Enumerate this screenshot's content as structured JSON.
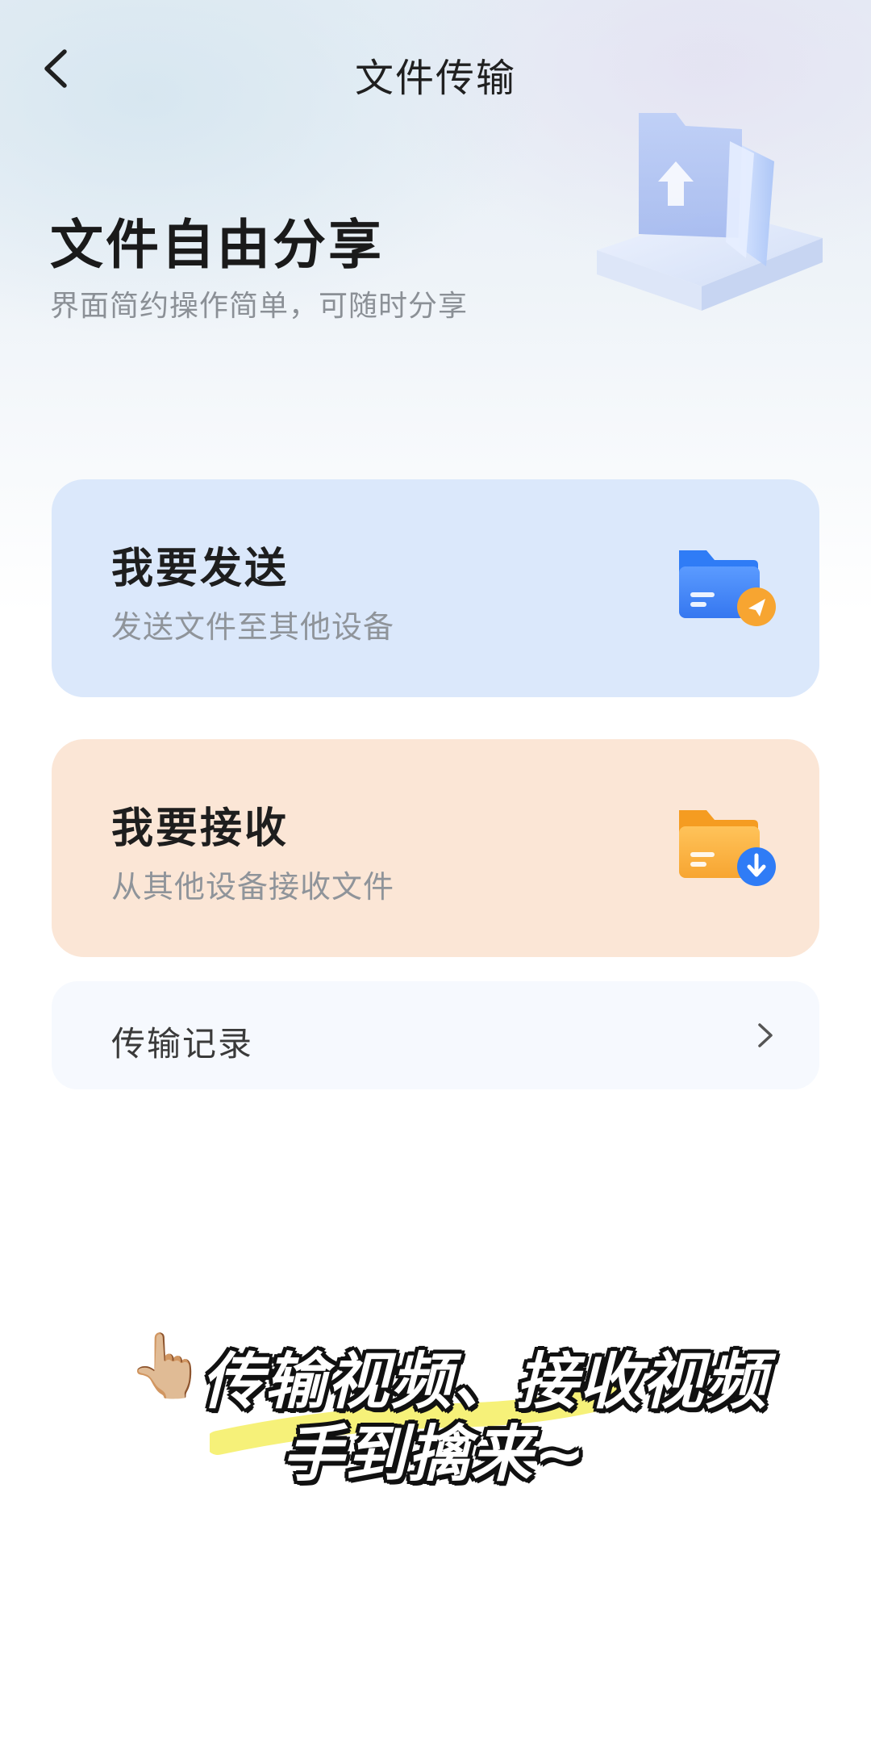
{
  "header": {
    "title": "文件传输",
    "back_icon": "chevron-left-icon"
  },
  "hero": {
    "title": "文件自由分享",
    "subtitle": "界面简约操作简单，可随时分享",
    "illustration": "folder-upload-illustration"
  },
  "cards": {
    "send": {
      "title": "我要发送",
      "subtitle": "发送文件至其他设备",
      "icon": "folder-send-icon",
      "background": "#dbe8fb",
      "accent": "#2f7cf6",
      "badge_color": "#f7a531"
    },
    "receive": {
      "title": "我要接收",
      "subtitle": "从其他设备接收文件",
      "icon": "folder-download-icon",
      "background": "#fbe6d6",
      "accent": "#f7a531",
      "badge_color": "#2f7cf6"
    }
  },
  "record": {
    "label": "传输记录",
    "chevron_icon": "chevron-right-icon"
  },
  "caption": {
    "hand_emoji": "👆🏼",
    "line1": "传输视频、接收视频",
    "line2": "手到擒来~",
    "highlight_color": "#f5f06a"
  }
}
